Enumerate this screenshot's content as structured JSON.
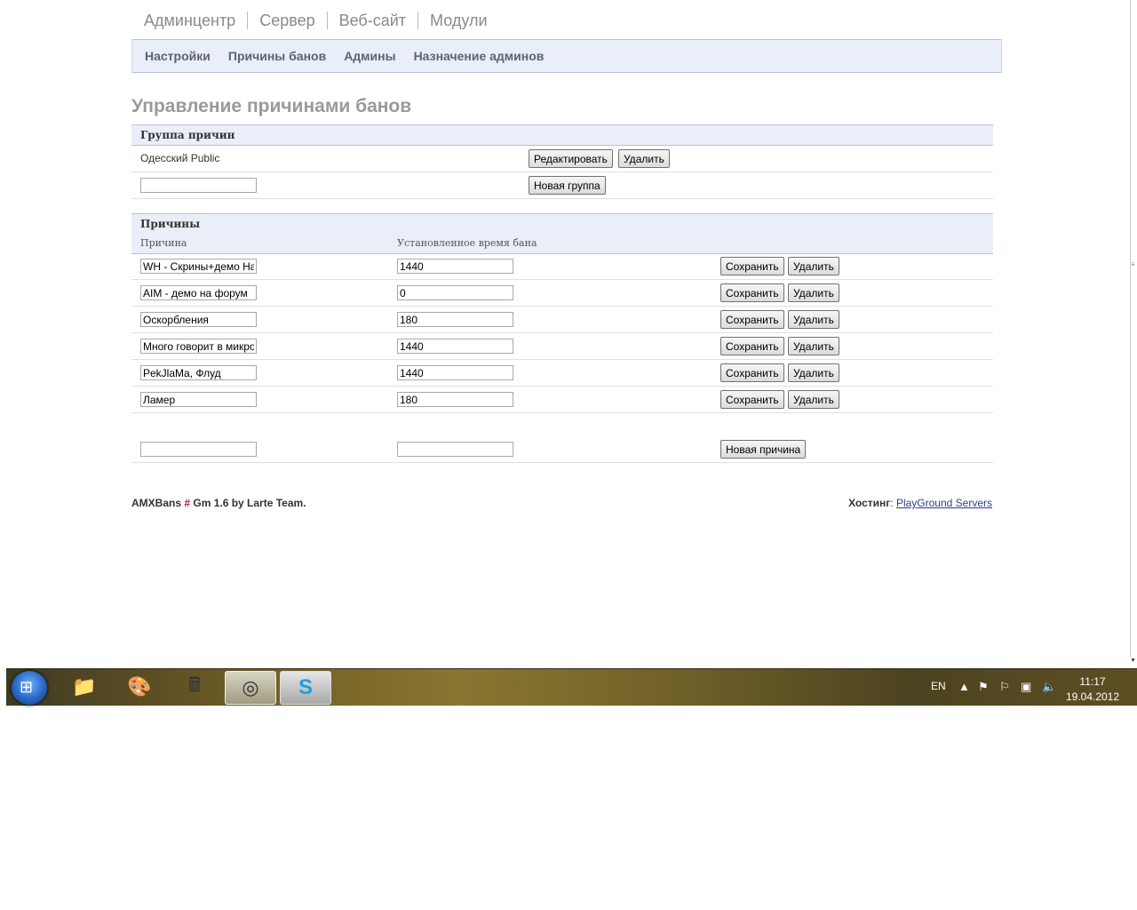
{
  "topnav": [
    "Админцентр",
    "Сервер",
    "Веб-сайт",
    "Модули"
  ],
  "subnav": [
    "Настройки",
    "Причины банов",
    "Админы",
    "Назначение админов"
  ],
  "page_title": "Управление причинами банов",
  "groups": {
    "title": "Группа причин",
    "items": [
      {
        "name": "Одесский Public",
        "edit_label": "Редактировать",
        "delete_label": "Удалить"
      }
    ],
    "new_value": "",
    "new_label": "Новая группа"
  },
  "reasons": {
    "title": "Причины",
    "col_reason": "Причина",
    "col_time": "Установленное время бана",
    "save_label": "Сохранить",
    "delete_label": "Удалить",
    "rows": [
      {
        "reason": "WH - Скрины+демо На",
        "time": "1440"
      },
      {
        "reason": "AIM - демо на форум",
        "time": "0"
      },
      {
        "reason": "Оскорбления",
        "time": "180"
      },
      {
        "reason": "Много говорит в микро",
        "time": "1440"
      },
      {
        "reason": "PekJlaMa, Флуд",
        "time": "1440"
      },
      {
        "reason": "Ламер",
        "time": "180"
      }
    ],
    "new_reason": "",
    "new_time": "",
    "new_label": "Новая причина"
  },
  "footer": {
    "left_a": "AMXBans ",
    "left_hash": "#",
    "left_b": " Gm 1.6 by Larte Team.",
    "hosting_label": "Хостинг",
    "hosting_sep": ": ",
    "hosting_link": "PlayGround Servers"
  },
  "taskbar": {
    "lang": "EN",
    "time": "11:17",
    "date": "19.04.2012",
    "icons": [
      "windows-start-icon",
      "file-explorer-icon",
      "paint-icon",
      "calculator-icon",
      "chrome-icon",
      "skype-icon"
    ]
  }
}
